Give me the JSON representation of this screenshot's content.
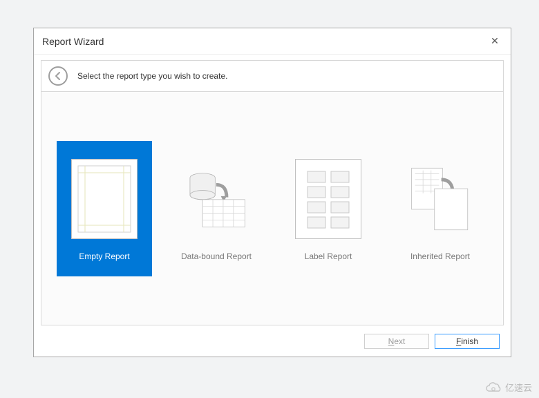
{
  "dialog": {
    "title": "Report Wizard",
    "close_glyph": "✕",
    "instruction": "Select the report type you wish to create."
  },
  "options": [
    {
      "label": "Empty Report",
      "selected": true
    },
    {
      "label": "Data-bound Report",
      "selected": false
    },
    {
      "label": "Label Report",
      "selected": false
    },
    {
      "label": "Inherited Report",
      "selected": false
    }
  ],
  "buttons": {
    "next": {
      "mnemonic": "N",
      "rest": "ext",
      "enabled": false
    },
    "finish": {
      "mnemonic": "F",
      "rest": "inish",
      "enabled": true
    }
  },
  "watermark": "亿速云"
}
